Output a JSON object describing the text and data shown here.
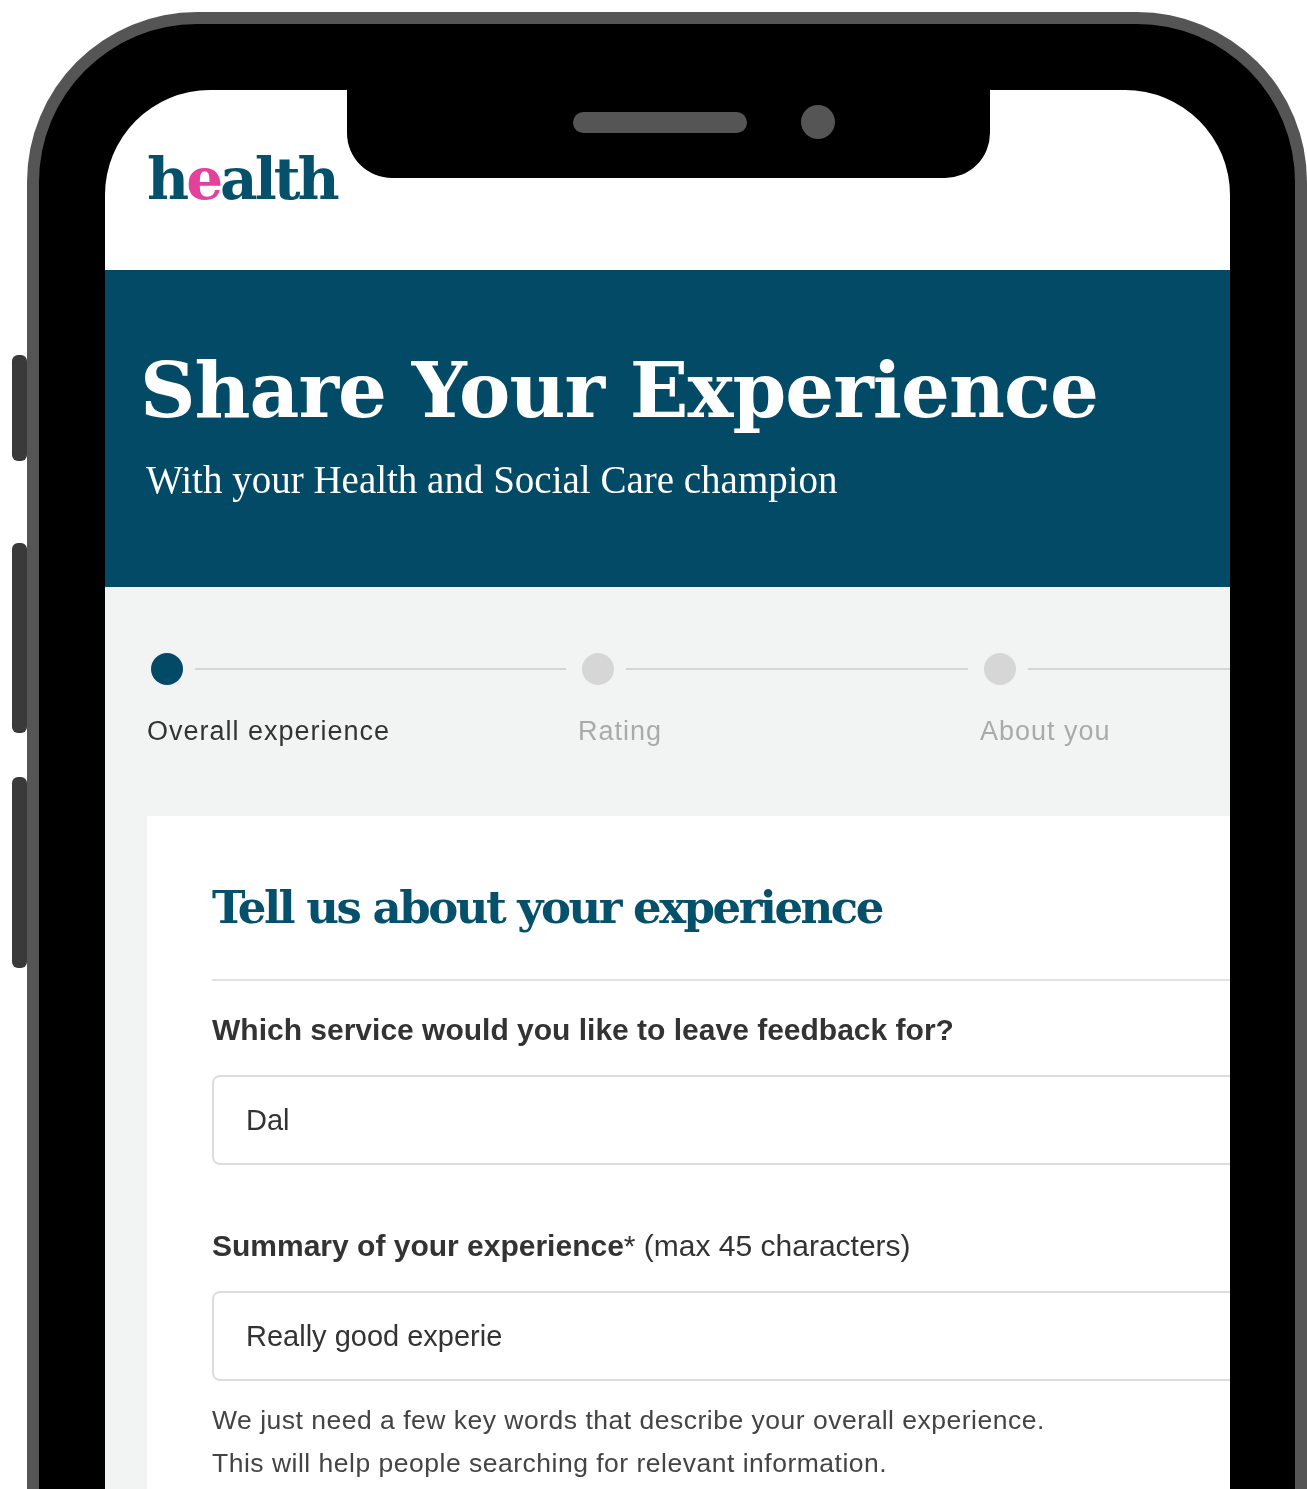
{
  "logo": {
    "parts": [
      {
        "text": "h",
        "color": "#05506b"
      },
      {
        "text": "e",
        "color": "#e4419a"
      },
      {
        "text": "alth",
        "color": "#05506b"
      }
    ]
  },
  "banner": {
    "title": "Share Your Experience",
    "subtitle": "With your Health and Social Care champion"
  },
  "steps": [
    {
      "label": "Overall experience",
      "selected": true
    },
    {
      "label": "Rating",
      "selected": false
    },
    {
      "label": "About you",
      "selected": false
    }
  ],
  "form": {
    "heading": "Tell us about your experience",
    "fields": [
      {
        "label": "Which service would you like to leave feedback for?",
        "value": "Dal"
      },
      {
        "label": "**Summary of your experience*** (max 45 characters)",
        "value": "Really good experie",
        "help": [
          "We just need a few key words that describe your overall experience.",
          "This will help people searching for relevant information."
        ]
      }
    ]
  }
}
